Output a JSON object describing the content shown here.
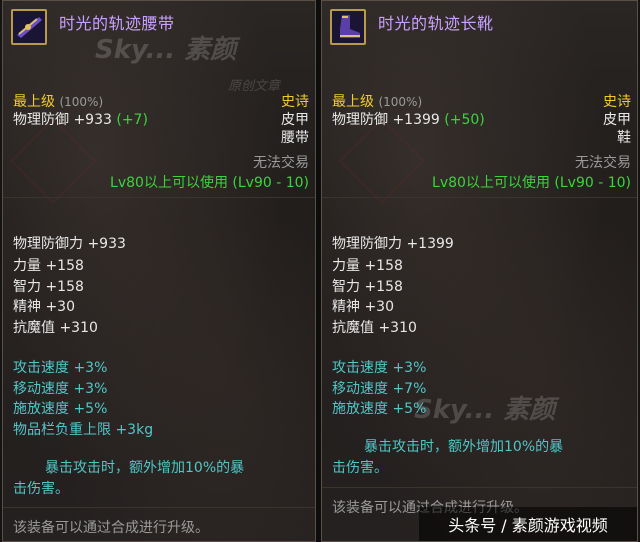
{
  "left": {
    "name": "时光的轨迹腰带",
    "grade": "最上级",
    "grade_pct": "(100%)",
    "rarity": "史诗",
    "defense_label": "物理防御",
    "defense_value": "+933",
    "defense_bonus": "(+7)",
    "armor_type": "皮甲",
    "slot": "腰带",
    "trade": "无法交易",
    "level_req": "Lv80以上可以使用 (Lv90 - 10)",
    "stats": [
      "物理防御力 +933",
      "力量 +158",
      "智力 +158",
      "精神 +30",
      "抗魔值 +310"
    ],
    "effects": [
      "攻击速度 +3%",
      "移动速度 +3%",
      "施放速度 +5%",
      "物品栏负重上限 +3kg"
    ],
    "crit_line1": "暴击攻击时，额外增加10%的暴",
    "crit_line2": "击伤害。",
    "upgrade": "该装备可以通过合成进行升级。"
  },
  "right": {
    "name": "时光的轨迹长靴",
    "grade": "最上级",
    "grade_pct": "(100%)",
    "rarity": "史诗",
    "defense_label": "物理防御",
    "defense_value": "+1399",
    "defense_bonus": "(+50)",
    "armor_type": "皮甲",
    "slot": "鞋",
    "trade": "无法交易",
    "level_req": "Lv80以上可以使用 (Lv90 - 10)",
    "stats": [
      "物理防御力 +1399",
      "力量 +158",
      "智力 +158",
      "精神 +30",
      "抗魔值 +310"
    ],
    "effects": [
      "攻击速度 +3%",
      "移动速度 +7%",
      "施放速度 +5%"
    ],
    "crit_line1": "暴击攻击时，额外增加10%的暴",
    "crit_line2": "击伤害。",
    "upgrade": "该装备可以通过合成进行升级。"
  },
  "watermark": {
    "brand": "Sky... 素颜",
    "sub": "原创文章",
    "footer": "头条号 / 素颜游戏视频"
  },
  "colors": {
    "item_name": "#c9a0ff",
    "grade": "#f2cc2a",
    "green": "#3cd33c",
    "cyan": "#4fc7c7"
  },
  "icons": {
    "left_item": "belt-icon",
    "right_item": "boots-icon"
  }
}
